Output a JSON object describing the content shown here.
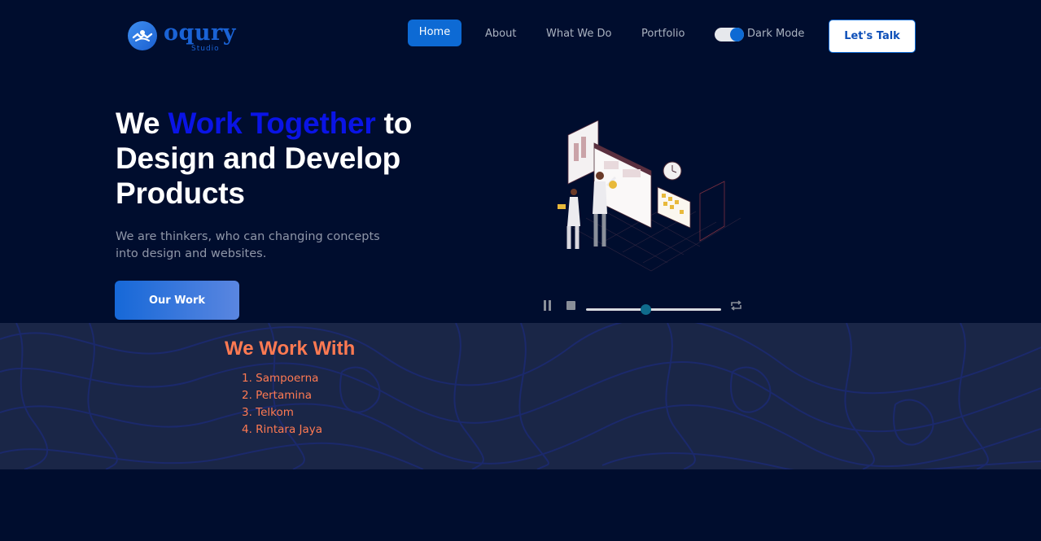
{
  "brand": {
    "name": "oqury",
    "sub": "Studio",
    "primary_color": "#0d6ad4"
  },
  "nav": {
    "home": "Home",
    "about": "About",
    "what_we_do": "What We Do",
    "portfolio": "Portfolio",
    "dark_mode_label": "Dark Mode",
    "dark_mode_on": true,
    "cta": "Let's Talk"
  },
  "hero": {
    "title_pre": "We ",
    "title_accent": "Work Together",
    "title_post": " to Design and Develop Products",
    "subtitle": "We are thinkers, who can changing concepts into design and websites.",
    "button": "Our Work"
  },
  "player": {
    "progress": 0.44,
    "icons": [
      "pause-icon",
      "stop-icon",
      "loop-icon"
    ]
  },
  "work_with": {
    "title": "We Work With",
    "items": [
      "1. Sampoerna",
      "2. Pertamina",
      "3. Telkom",
      "4. Rintara Jaya"
    ],
    "accent_color": "#ff7a52"
  }
}
